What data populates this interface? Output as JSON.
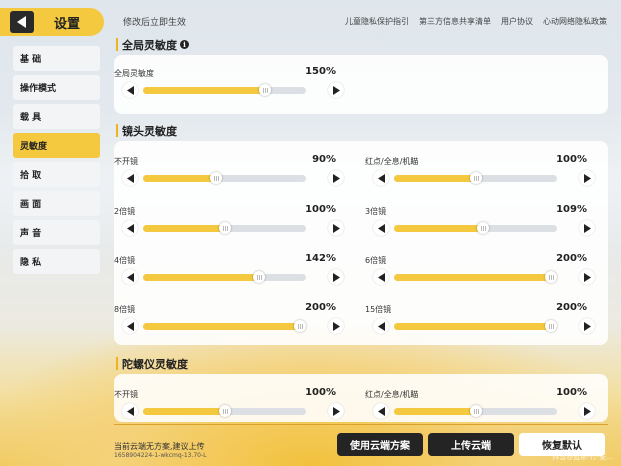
{
  "header": {
    "title": "设置"
  },
  "hint": "修改后立即生效",
  "top_links": [
    "儿童隐私保护指引",
    "第三方信息共享清单",
    "用户协议",
    "心动网络隐私政策"
  ],
  "sidebar": {
    "items": [
      {
        "label": "基 础",
        "active": false
      },
      {
        "label": "操作模式",
        "active": false
      },
      {
        "label": "载 具",
        "active": false
      },
      {
        "label": "灵敏度",
        "active": true
      },
      {
        "label": "拾 取",
        "active": false
      },
      {
        "label": "画 面",
        "active": false
      },
      {
        "label": "声 音",
        "active": false
      },
      {
        "label": "隐 私",
        "active": false
      }
    ]
  },
  "sections": {
    "global": {
      "title": "全局灵敏度",
      "sliders": [
        {
          "label": "全局灵敏度",
          "value": "150%",
          "fraction": 0.75
        }
      ]
    },
    "scope": {
      "title": "镜头灵敏度",
      "sliders": [
        {
          "label": "不开镜",
          "value": "90%",
          "fraction": 0.45
        },
        {
          "label": "红点/全息/机瞄",
          "value": "100%",
          "fraction": 0.5
        },
        {
          "label": "2倍镜",
          "value": "100%",
          "fraction": 0.5
        },
        {
          "label": "3倍镜",
          "value": "109%",
          "fraction": 0.545
        },
        {
          "label": "4倍镜",
          "value": "142%",
          "fraction": 0.71
        },
        {
          "label": "6倍镜",
          "value": "200%",
          "fraction": 1.0
        },
        {
          "label": "8倍镜",
          "value": "200%",
          "fraction": 1.0
        },
        {
          "label": "15倍镜",
          "value": "200%",
          "fraction": 1.0
        }
      ]
    },
    "gyro": {
      "title": "陀螺仪灵敏度",
      "sliders": [
        {
          "label": "不开镜",
          "value": "100%",
          "fraction": 0.5
        },
        {
          "label": "红点/全息/机瞄",
          "value": "100%",
          "fraction": 0.5
        }
      ]
    }
  },
  "bottom": {
    "status": "当前云端无方案,建议上传",
    "build_id": "1658904224-1-wkcmq-13.70-L",
    "buttons": {
      "use_cloud": "使用云端方案",
      "upload": "上传云端",
      "reset": "恢复默认"
    },
    "watermark": "抖音@蓝斯-打-麦..."
  },
  "colors": {
    "accent": "#f4c93f",
    "dark": "#242424"
  }
}
